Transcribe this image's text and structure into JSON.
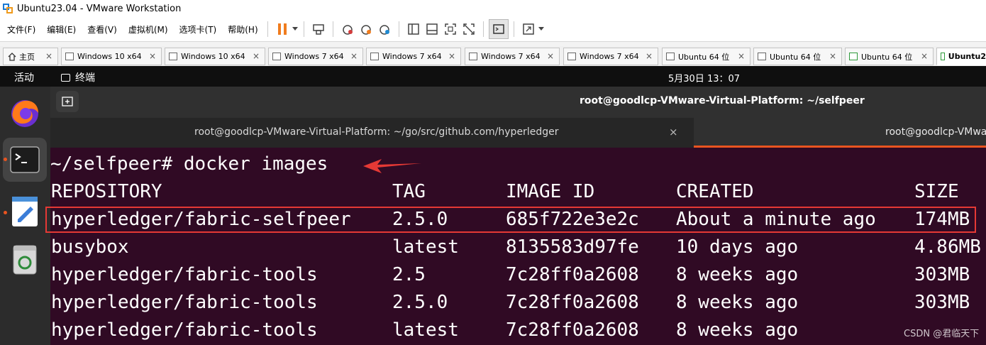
{
  "window": {
    "title": "Ubuntu23.04 - VMware Workstation"
  },
  "menubar": {
    "items": [
      "文件(F)",
      "编辑(E)",
      "查看(V)",
      "虚拟机(M)",
      "选项卡(T)",
      "帮助(H)"
    ]
  },
  "toolbar": {
    "icons": [
      "pause-icon",
      "send-ctrl-alt-del-icon",
      "snapshot-icon",
      "revert-snapshot-icon",
      "manage-snapshots-icon",
      "sidebar-icon",
      "console-view-icon",
      "fullscreen-icon",
      "unity-icon",
      "terminal-icon",
      "stretch-icon"
    ]
  },
  "vm_tabs": [
    {
      "label": "主页",
      "icon": "home-icon"
    },
    {
      "label": "Windows 10 x64",
      "icon": "vm-icon"
    },
    {
      "label": "Windows 10 x64",
      "icon": "vm-icon"
    },
    {
      "label": "Windows 7 x64",
      "icon": "vm-icon"
    },
    {
      "label": "Windows 7 x64",
      "icon": "vm-icon"
    },
    {
      "label": "Windows 7 x64",
      "icon": "vm-icon"
    },
    {
      "label": "Windows 7 x64",
      "icon": "vm-icon"
    },
    {
      "label": "Ubuntu 64 位",
      "icon": "vm-icon"
    },
    {
      "label": "Ubuntu 64 位",
      "icon": "vm-icon"
    },
    {
      "label": "Ubuntu 64 位",
      "icon": "vm-running-icon"
    },
    {
      "label": "Ubuntu2",
      "icon": "vm-running-icon"
    }
  ],
  "ubuntu_panel": {
    "activities": "活动",
    "app_name": "终端",
    "clock": "5月30日 13：07"
  },
  "dock": {
    "items": [
      "firefox-icon",
      "terminal-icon",
      "text-editor-icon",
      "trash-icon"
    ]
  },
  "terminal": {
    "title": "root@goodlcp-VMware-Virtual-Platform: ~/selfpeer",
    "tabs": [
      "root@goodlcp-VMware-Virtual-Platform: ~/go/src/github.com/hyperledger",
      "root@goodlcp-VMware-Virtual-Platform: ~/selfpeer"
    ],
    "close_symbol": "×",
    "new_tab_symbol": "+",
    "command_line": "~/selfpeer# docker images",
    "headers": [
      "REPOSITORY",
      "TAG",
      "IMAGE ID",
      "CREATED",
      "SIZE"
    ],
    "rows": [
      [
        "hyperledger/fabric-selfpeer",
        "2.5.0",
        "685f722e3e2c",
        "About a minute ago",
        "174MB"
      ],
      [
        "busybox",
        "latest",
        "8135583d97fe",
        "10 days ago",
        "4.86MB"
      ],
      [
        "hyperledger/fabric-tools",
        "2.5",
        "7c28ff0a2608",
        "8 weeks ago",
        "303MB"
      ],
      [
        "hyperledger/fabric-tools",
        "2.5.0",
        "7c28ff0a2608",
        "8 weeks ago",
        "303MB"
      ],
      [
        "hyperledger/fabric-tools",
        "latest",
        "7c28ff0a2608",
        "8 weeks ago",
        "303MB"
      ]
    ],
    "highlight_color": "#e53935"
  },
  "watermark": "CSDN @君临天下"
}
